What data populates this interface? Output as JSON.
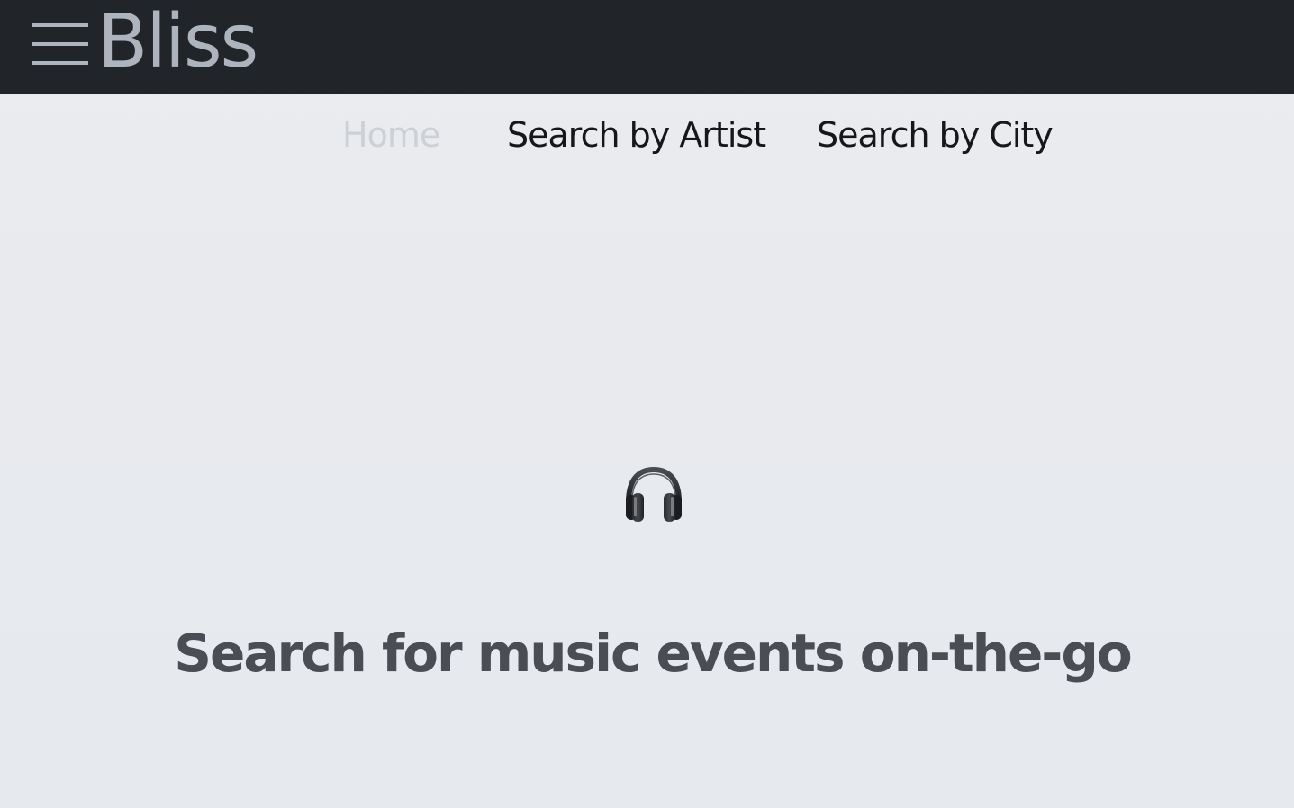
{
  "header": {
    "brand": "Bliss",
    "menu_icon": "hamburger-menu-icon",
    "colors": {
      "background": "#212429",
      "foreground": "#aeb4bd"
    }
  },
  "nav": {
    "items": [
      {
        "label": "Home",
        "state": "active"
      },
      {
        "label": "Search by Artist",
        "state": "default"
      },
      {
        "label": "Search by City",
        "state": "default"
      }
    ]
  },
  "hero": {
    "icon": "headphones-icon",
    "tagline": "Search for music events on-the-go"
  },
  "colors": {
    "page_background": "#e8eaee",
    "nav_active": "#cdd1d6",
    "nav_default": "#15171a",
    "tagline": "#4a4d53"
  }
}
